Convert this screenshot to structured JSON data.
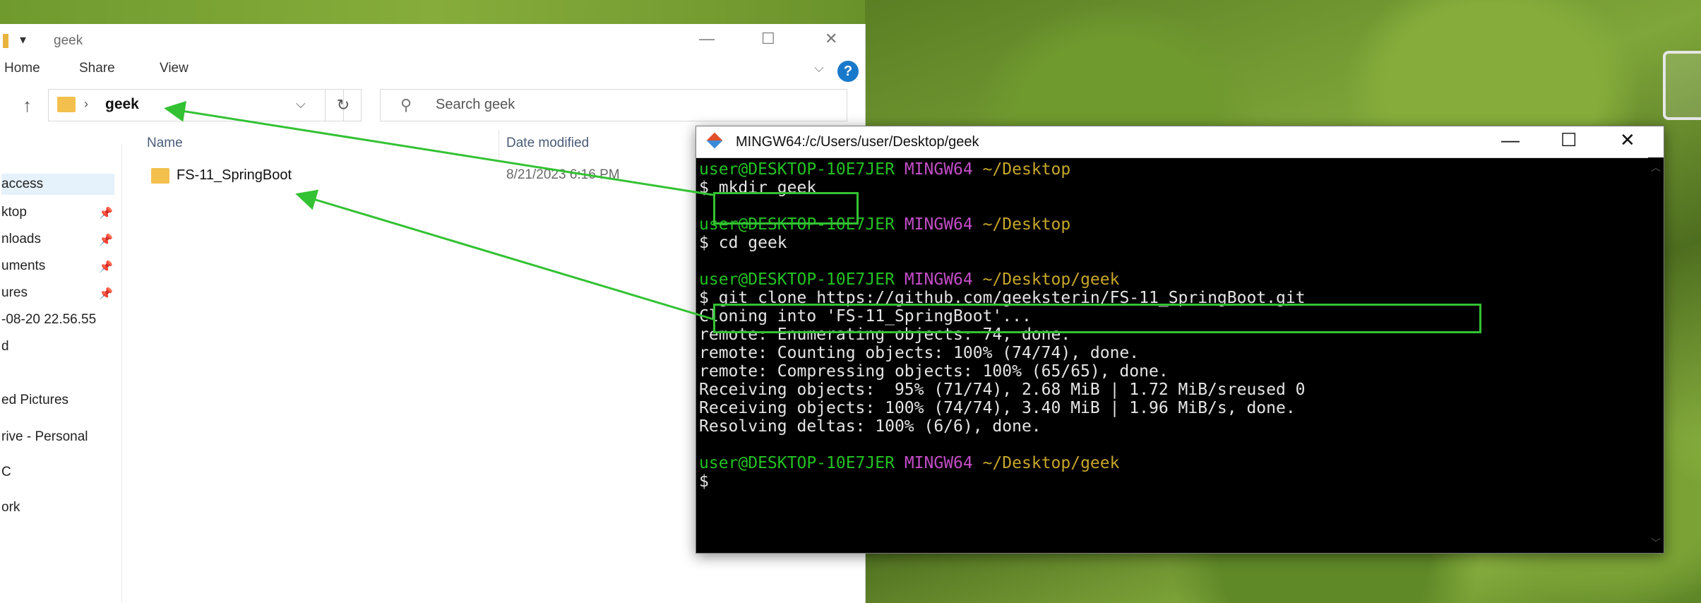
{
  "explorer": {
    "title": "geek",
    "quick_access_glyph": "▾",
    "menu": {
      "home": "Home",
      "share": "Share",
      "view": "View"
    },
    "controls": {
      "minimize": "—",
      "maximize": "☐",
      "close": "✕"
    },
    "help": "?",
    "address": {
      "separator": "›",
      "folder": "geek"
    },
    "search_placeholder": "Search geek",
    "nav_items": [
      {
        "label": "access",
        "pinned": false
      },
      {
        "label": "ktop",
        "pinned": true
      },
      {
        "label": "nloads",
        "pinned": true
      },
      {
        "label": "uments",
        "pinned": true
      },
      {
        "label": "ures",
        "pinned": true
      },
      {
        "label": "-08-20 22.56.55",
        "pinned": false
      },
      {
        "label": "d",
        "pinned": false
      },
      {
        "label": "ed Pictures",
        "pinned": false
      },
      {
        "label": "rive - Personal",
        "pinned": false
      },
      {
        "label": "C",
        "pinned": false
      },
      {
        "label": "ork",
        "pinned": false
      }
    ],
    "columns": {
      "name": "Name",
      "date": "Date modified"
    },
    "files": [
      {
        "name": "FS-11_SpringBoot",
        "date": "8/21/2023 6:16 PM"
      }
    ]
  },
  "terminal": {
    "title": "MINGW64:/c/Users/user/Desktop/geek",
    "controls": {
      "minimize": "—",
      "maximize": "☐",
      "close": "✕"
    },
    "prompt": {
      "user": "user@DESKTOP-10E7JER",
      "shell": "MINGW64",
      "dollar": "$"
    },
    "lines": {
      "p1_path": "~/Desktop",
      "cmd1": "mkdir geek",
      "p2_path": "~/Desktop",
      "cmd2": "cd geek",
      "p3_path": "~/Desktop/geek",
      "cmd3": "git clone https://github.com/geeksterin/FS-11_SpringBoot.git",
      "out1": "Cloning into 'FS-11_SpringBoot'...",
      "out2": "remote: Enumerating objects: 74, done.",
      "out3": "remote: Counting objects: 100% (74/74), done.",
      "out4": "remote: Compressing objects: 100% (65/65), done.",
      "out5": "Receiving objects:  95% (71/74), 2.68 MiB | 1.72 MiB/sreused 0",
      "out6": "Receiving objects: 100% (74/74), 3.40 MiB | 1.96 MiB/s, done.",
      "out7": "Resolving deltas: 100% (6/6), done.",
      "p4_path": "~/Desktop/geek"
    }
  },
  "colors": {
    "annotation": "#33c233",
    "prompt_user": "#23c223",
    "prompt_shell": "#c34dc7",
    "prompt_path": "#c7a72a",
    "folder": "#f3c04d"
  }
}
